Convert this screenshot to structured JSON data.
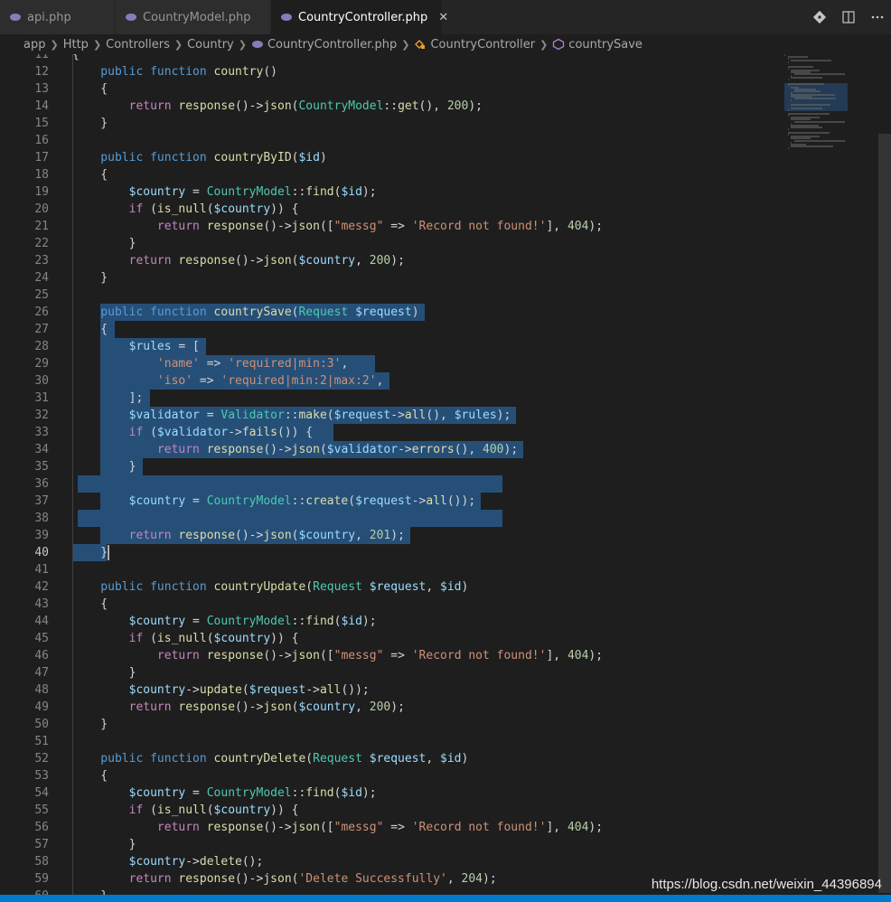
{
  "tabs": [
    {
      "label": "api.php",
      "active": false
    },
    {
      "label": "CountryModel.php",
      "active": false
    },
    {
      "label": "CountryController.php",
      "active": true
    }
  ],
  "tab_close_glyph": "✕",
  "tab_actions": [
    "git-compare-icon",
    "split-editor-icon",
    "more-actions-icon"
  ],
  "breadcrumb": [
    "app",
    "Http",
    "Controllers",
    "Country",
    "CountryController.php",
    "CountryController",
    "countrySave"
  ],
  "editor": {
    "first_line": 11,
    "current_line": 40,
    "lines": [
      [
        [
          "pl",
          "{"
        ]
      ],
      [
        [
          "kw",
          "    public "
        ],
        [
          "kw",
          "function "
        ],
        [
          "fn",
          "country"
        ],
        [
          "pl",
          "()"
        ]
      ],
      [
        [
          "pl",
          "    {"
        ]
      ],
      [
        [
          "ctl",
          "        return "
        ],
        [
          "fn",
          "response"
        ],
        [
          "pl",
          "()->"
        ],
        [
          "fn",
          "json"
        ],
        [
          "pl",
          "("
        ],
        [
          "cls",
          "CountryModel"
        ],
        [
          "pl",
          "::"
        ],
        [
          "fn",
          "get"
        ],
        [
          "pl",
          "(), "
        ],
        [
          "num",
          "200"
        ],
        [
          "pl",
          ");"
        ]
      ],
      [
        [
          "pl",
          "    }"
        ]
      ],
      [
        [
          "pl",
          ""
        ]
      ],
      [
        [
          "kw",
          "    public "
        ],
        [
          "kw",
          "function "
        ],
        [
          "fn",
          "countryByID"
        ],
        [
          "pl",
          "("
        ],
        [
          "var",
          "$id"
        ],
        [
          "pl",
          ")"
        ]
      ],
      [
        [
          "pl",
          "    {"
        ]
      ],
      [
        [
          "var",
          "        $country"
        ],
        [
          "pl",
          " = "
        ],
        [
          "cls",
          "CountryModel"
        ],
        [
          "pl",
          "::"
        ],
        [
          "fn",
          "find"
        ],
        [
          "pl",
          "("
        ],
        [
          "var",
          "$id"
        ],
        [
          "pl",
          ");"
        ]
      ],
      [
        [
          "ctl",
          "        if "
        ],
        [
          "pl",
          "("
        ],
        [
          "fn",
          "is_null"
        ],
        [
          "pl",
          "("
        ],
        [
          "var",
          "$country"
        ],
        [
          "pl",
          ")) {"
        ]
      ],
      [
        [
          "ctl",
          "            return "
        ],
        [
          "fn",
          "response"
        ],
        [
          "pl",
          "()->"
        ],
        [
          "fn",
          "json"
        ],
        [
          "pl",
          "(["
        ],
        [
          "str",
          "\"messg\""
        ],
        [
          "pl",
          " => "
        ],
        [
          "str",
          "'Record not found!'"
        ],
        [
          "pl",
          "], "
        ],
        [
          "num",
          "404"
        ],
        [
          "pl",
          ");"
        ]
      ],
      [
        [
          "pl",
          "        }"
        ]
      ],
      [
        [
          "ctl",
          "        return "
        ],
        [
          "fn",
          "response"
        ],
        [
          "pl",
          "()->"
        ],
        [
          "fn",
          "json"
        ],
        [
          "pl",
          "("
        ],
        [
          "var",
          "$country"
        ],
        [
          "pl",
          ", "
        ],
        [
          "num",
          "200"
        ],
        [
          "pl",
          ");"
        ]
      ],
      [
        [
          "pl",
          "    }"
        ]
      ],
      [
        [
          "pl",
          ""
        ]
      ],
      [
        [
          "kw",
          "    public "
        ],
        [
          "kw",
          "function "
        ],
        [
          "fn",
          "countrySave"
        ],
        [
          "pl",
          "("
        ],
        [
          "cls",
          "Request "
        ],
        [
          "var",
          "$request"
        ],
        [
          "pl",
          ")"
        ]
      ],
      [
        [
          "pl",
          "    {"
        ]
      ],
      [
        [
          "var",
          "        $rules"
        ],
        [
          "pl",
          " = ["
        ]
      ],
      [
        [
          "str",
          "            'name'"
        ],
        [
          "pl",
          " => "
        ],
        [
          "str",
          "'required|min:3'"
        ],
        [
          "pl",
          ","
        ]
      ],
      [
        [
          "str",
          "            'iso'"
        ],
        [
          "pl",
          " => "
        ],
        [
          "str",
          "'required|min:2|max:2'"
        ],
        [
          "pl",
          ","
        ]
      ],
      [
        [
          "pl",
          "        ];"
        ]
      ],
      [
        [
          "var",
          "        $validator"
        ],
        [
          "pl",
          " = "
        ],
        [
          "cls",
          "Validator"
        ],
        [
          "pl",
          "::"
        ],
        [
          "fn",
          "make"
        ],
        [
          "pl",
          "("
        ],
        [
          "var",
          "$request"
        ],
        [
          "pl",
          "->"
        ],
        [
          "fn",
          "all"
        ],
        [
          "pl",
          "(), "
        ],
        [
          "var",
          "$rules"
        ],
        [
          "pl",
          ");"
        ]
      ],
      [
        [
          "ctl",
          "        if "
        ],
        [
          "pl",
          "("
        ],
        [
          "var",
          "$validator"
        ],
        [
          "pl",
          "->"
        ],
        [
          "fn",
          "fails"
        ],
        [
          "pl",
          "()) {"
        ]
      ],
      [
        [
          "ctl",
          "            return "
        ],
        [
          "fn",
          "response"
        ],
        [
          "pl",
          "()->"
        ],
        [
          "fn",
          "json"
        ],
        [
          "pl",
          "("
        ],
        [
          "var",
          "$validator"
        ],
        [
          "pl",
          "->"
        ],
        [
          "fn",
          "errors"
        ],
        [
          "pl",
          "(), "
        ],
        [
          "num",
          "400"
        ],
        [
          "pl",
          ");"
        ]
      ],
      [
        [
          "pl",
          "        }"
        ]
      ],
      [
        [
          "pl",
          ""
        ]
      ],
      [
        [
          "var",
          "        $country"
        ],
        [
          "pl",
          " = "
        ],
        [
          "cls",
          "CountryModel"
        ],
        [
          "pl",
          "::"
        ],
        [
          "fn",
          "create"
        ],
        [
          "pl",
          "("
        ],
        [
          "var",
          "$request"
        ],
        [
          "pl",
          "->"
        ],
        [
          "fn",
          "all"
        ],
        [
          "pl",
          "());"
        ]
      ],
      [
        [
          "pl",
          ""
        ]
      ],
      [
        [
          "ctl",
          "        return "
        ],
        [
          "fn",
          "response"
        ],
        [
          "pl",
          "()->"
        ],
        [
          "fn",
          "json"
        ],
        [
          "pl",
          "("
        ],
        [
          "var",
          "$country"
        ],
        [
          "pl",
          ", "
        ],
        [
          "num",
          "201"
        ],
        [
          "pl",
          ");"
        ]
      ],
      [
        [
          "pl",
          "    }"
        ]
      ],
      [
        [
          "pl",
          ""
        ]
      ],
      [
        [
          "kw",
          "    public "
        ],
        [
          "kw",
          "function "
        ],
        [
          "fn",
          "countryUpdate"
        ],
        [
          "pl",
          "("
        ],
        [
          "cls",
          "Request "
        ],
        [
          "var",
          "$request"
        ],
        [
          "pl",
          ", "
        ],
        [
          "var",
          "$id"
        ],
        [
          "pl",
          ")"
        ]
      ],
      [
        [
          "pl",
          "    {"
        ]
      ],
      [
        [
          "var",
          "        $country"
        ],
        [
          "pl",
          " = "
        ],
        [
          "cls",
          "CountryModel"
        ],
        [
          "pl",
          "::"
        ],
        [
          "fn",
          "find"
        ],
        [
          "pl",
          "("
        ],
        [
          "var",
          "$id"
        ],
        [
          "pl",
          ");"
        ]
      ],
      [
        [
          "ctl",
          "        if "
        ],
        [
          "pl",
          "("
        ],
        [
          "fn",
          "is_null"
        ],
        [
          "pl",
          "("
        ],
        [
          "var",
          "$country"
        ],
        [
          "pl",
          ")) {"
        ]
      ],
      [
        [
          "ctl",
          "            return "
        ],
        [
          "fn",
          "response"
        ],
        [
          "pl",
          "()->"
        ],
        [
          "fn",
          "json"
        ],
        [
          "pl",
          "(["
        ],
        [
          "str",
          "\"messg\""
        ],
        [
          "pl",
          " => "
        ],
        [
          "str",
          "'Record not found!'"
        ],
        [
          "pl",
          "], "
        ],
        [
          "num",
          "404"
        ],
        [
          "pl",
          ");"
        ]
      ],
      [
        [
          "pl",
          "        }"
        ]
      ],
      [
        [
          "var",
          "        $country"
        ],
        [
          "pl",
          "->"
        ],
        [
          "fn",
          "update"
        ],
        [
          "pl",
          "("
        ],
        [
          "var",
          "$request"
        ],
        [
          "pl",
          "->"
        ],
        [
          "fn",
          "all"
        ],
        [
          "pl",
          "());"
        ]
      ],
      [
        [
          "ctl",
          "        return "
        ],
        [
          "fn",
          "response"
        ],
        [
          "pl",
          "()->"
        ],
        [
          "fn",
          "json"
        ],
        [
          "pl",
          "("
        ],
        [
          "var",
          "$country"
        ],
        [
          "pl",
          ", "
        ],
        [
          "num",
          "200"
        ],
        [
          "pl",
          ");"
        ]
      ],
      [
        [
          "pl",
          "    }"
        ]
      ],
      [
        [
          "pl",
          ""
        ]
      ],
      [
        [
          "kw",
          "    public "
        ],
        [
          "kw",
          "function "
        ],
        [
          "fn",
          "countryDelete"
        ],
        [
          "pl",
          "("
        ],
        [
          "cls",
          "Request "
        ],
        [
          "var",
          "$request"
        ],
        [
          "pl",
          ", "
        ],
        [
          "var",
          "$id"
        ],
        [
          "pl",
          ")"
        ]
      ],
      [
        [
          "pl",
          "    {"
        ]
      ],
      [
        [
          "var",
          "        $country"
        ],
        [
          "pl",
          " = "
        ],
        [
          "cls",
          "CountryModel"
        ],
        [
          "pl",
          "::"
        ],
        [
          "fn",
          "find"
        ],
        [
          "pl",
          "("
        ],
        [
          "var",
          "$id"
        ],
        [
          "pl",
          ");"
        ]
      ],
      [
        [
          "ctl",
          "        if "
        ],
        [
          "pl",
          "("
        ],
        [
          "fn",
          "is_null"
        ],
        [
          "pl",
          "("
        ],
        [
          "var",
          "$country"
        ],
        [
          "pl",
          ")) {"
        ]
      ],
      [
        [
          "ctl",
          "            return "
        ],
        [
          "fn",
          "response"
        ],
        [
          "pl",
          "()->"
        ],
        [
          "fn",
          "json"
        ],
        [
          "pl",
          "(["
        ],
        [
          "str",
          "\"messg\""
        ],
        [
          "pl",
          " => "
        ],
        [
          "str",
          "'Record not found!'"
        ],
        [
          "pl",
          "], "
        ],
        [
          "num",
          "404"
        ],
        [
          "pl",
          ");"
        ]
      ],
      [
        [
          "pl",
          "        }"
        ]
      ],
      [
        [
          "var",
          "        $country"
        ],
        [
          "pl",
          "->"
        ],
        [
          "fn",
          "delete"
        ],
        [
          "pl",
          "();"
        ]
      ],
      [
        [
          "ctl",
          "        return "
        ],
        [
          "fn",
          "response"
        ],
        [
          "pl",
          "()->"
        ],
        [
          "fn",
          "json"
        ],
        [
          "pl",
          "("
        ],
        [
          "str",
          "'Delete Successfully'"
        ],
        [
          "pl",
          ", "
        ],
        [
          "num",
          "204"
        ],
        [
          "pl",
          ");"
        ]
      ],
      [
        [
          "pl",
          "    }"
        ]
      ]
    ]
  },
  "watermark": "https://blog.csdn.net/weixin_44396894",
  "colors": {
    "editor_bg": "#1e1e1e",
    "selection": "#264f78",
    "status_bar": "#007acc"
  }
}
